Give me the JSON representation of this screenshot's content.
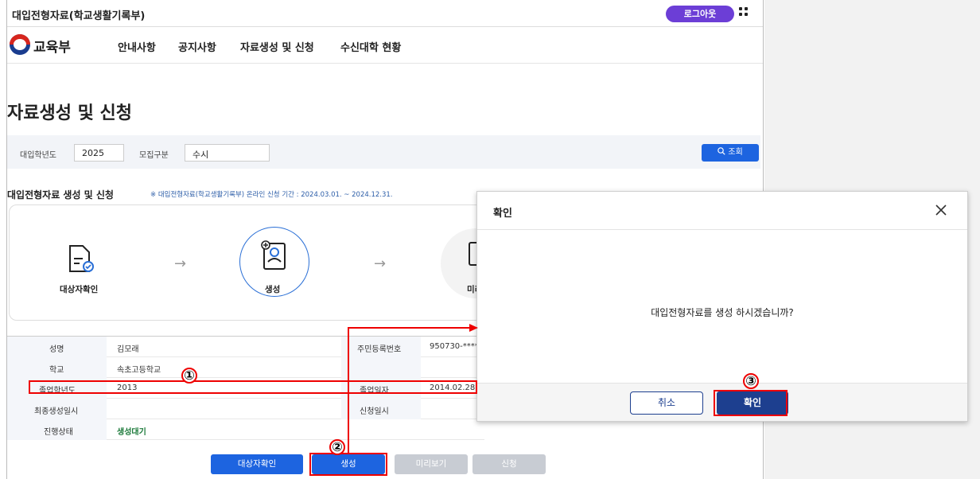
{
  "app": {
    "title": "대입전형자료(학교생활기록부)",
    "logout_label": "로그아웃",
    "logo_text": "교육부"
  },
  "nav": {
    "items": [
      "안내사항",
      "공지사항",
      "자료생성 및 신청",
      "수신대학 현황"
    ]
  },
  "page": {
    "title": "자료생성 및 신청"
  },
  "search": {
    "year_label": "대입학년도",
    "year_value": "2025",
    "type_label": "모집구분",
    "type_value": "수시",
    "button_label": "조회"
  },
  "section": {
    "title": "대입전형자료 생성 및 신청",
    "note": "※ 대입전형자료(학교생활기록부) 온라인 신청 기간 : 2024.03.01. ~ 2024.12.31."
  },
  "steps": [
    {
      "label": "대상자확인"
    },
    {
      "label": "생성"
    },
    {
      "label": "미리"
    }
  ],
  "info": {
    "name_label": "성명",
    "name_value": "김모래",
    "id_label": "주민등록번호",
    "id_value": "950730-*****",
    "school_label": "학교",
    "school_value": "속초고등학교",
    "grad_year_label": "졸업학년도",
    "grad_year_value": "2013",
    "grad_date_label": "졸업일자",
    "grad_date_value": "2014.02.28",
    "last_gen_label": "최종생성일시",
    "apply_date_label": "신청일시",
    "status_label": "진행상태",
    "status_value": "생성대기"
  },
  "buttons": {
    "check": "대상자확인",
    "generate": "생성",
    "preview": "미리보기",
    "apply": "신청"
  },
  "modal": {
    "title": "확인",
    "message": "대입전형자료를 생성 하시겠습니까?",
    "cancel_label": "취소",
    "ok_label": "확인"
  },
  "markers": [
    "①",
    "②",
    "③"
  ],
  "colors": {
    "primary": "#1d64e0",
    "navy": "#1d3f8f",
    "logout": "#6c3ed6",
    "highlight": "#e00000",
    "status_green": "#1c7a3a"
  }
}
